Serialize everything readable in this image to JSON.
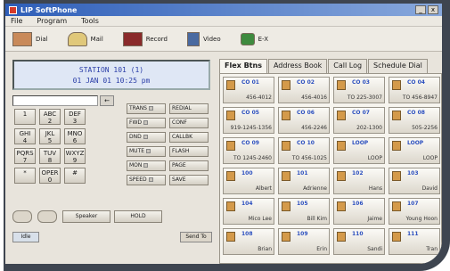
{
  "window": {
    "title": "LIP SoftPhone"
  },
  "menu": [
    "File",
    "Program",
    "Tools"
  ],
  "toolbar": [
    {
      "label": "Dial",
      "icon": "dial-icon"
    },
    {
      "label": "Mail",
      "icon": "mail-icon"
    },
    {
      "label": "Record",
      "icon": "record-icon"
    },
    {
      "label": "Video",
      "icon": "video-icon"
    },
    {
      "label": "E-X",
      "icon": "ex-icon"
    }
  ],
  "display": {
    "line1": "STATION 101 (1)",
    "line2": "01 JAN 01   10:25 pm"
  },
  "keypad": [
    {
      "main": "1",
      "sub": ""
    },
    {
      "main": "ABC",
      "sub": "2"
    },
    {
      "main": "DEF",
      "sub": "3"
    },
    {
      "main": "GHI",
      "sub": "4"
    },
    {
      "main": "JKL",
      "sub": "5"
    },
    {
      "main": "MNO",
      "sub": "6"
    },
    {
      "main": "PQRS",
      "sub": "7"
    },
    {
      "main": "TUV",
      "sub": "8"
    },
    {
      "main": "WXYZ",
      "sub": "9"
    },
    {
      "main": "*",
      "sub": ""
    },
    {
      "main": "OPER",
      "sub": "0"
    },
    {
      "main": "#",
      "sub": ""
    }
  ],
  "features": [
    [
      "TRANS",
      "REDIAL"
    ],
    [
      "FWD",
      "CONF"
    ],
    [
      "DND",
      "CALLBK"
    ],
    [
      "MUTE",
      "FLASH"
    ],
    [
      "MON",
      "PAGE"
    ],
    [
      "SPEED",
      "SAVE"
    ]
  ],
  "bottom": {
    "speaker": "Speaker",
    "hold": "HOLD"
  },
  "status": {
    "left": "Idle",
    "send": "Send To"
  },
  "tabs": [
    "Flex Btns",
    "Address Book",
    "Call Log",
    "Schedule Dial"
  ],
  "flex_buttons": [
    {
      "num": "CO 01",
      "label": "456-4012"
    },
    {
      "num": "CO 02",
      "label": "456-4016"
    },
    {
      "num": "CO 03",
      "label": "TO 225-3007"
    },
    {
      "num": "CO 04",
      "label": "TO 456-8947"
    },
    {
      "num": "CO 05",
      "label": "919-1245-1356"
    },
    {
      "num": "CO 06",
      "label": "456-2246"
    },
    {
      "num": "CO 07",
      "label": "202-1300"
    },
    {
      "num": "CO 08",
      "label": "505-2256"
    },
    {
      "num": "CO 09",
      "label": "TO 1245-2460"
    },
    {
      "num": "CO 10",
      "label": "TO 456-1025"
    },
    {
      "num": "LOOP",
      "label": "LOOP"
    },
    {
      "num": "LOOP",
      "label": "LOOP"
    },
    {
      "num": "100",
      "label": "Albert"
    },
    {
      "num": "101",
      "label": "Adrienne"
    },
    {
      "num": "102",
      "label": "Hans"
    },
    {
      "num": "103",
      "label": "David"
    },
    {
      "num": "104",
      "label": "Mico Lee"
    },
    {
      "num": "105",
      "label": "Bill Kim"
    },
    {
      "num": "106",
      "label": "Jaime"
    },
    {
      "num": "107",
      "label": "Young Hoon"
    },
    {
      "num": "108",
      "label": "Brian"
    },
    {
      "num": "109",
      "label": "Erin"
    },
    {
      "num": "110",
      "label": "Sandi"
    },
    {
      "num": "111",
      "label": "Tran"
    }
  ]
}
